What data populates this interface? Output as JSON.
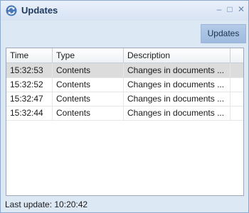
{
  "window": {
    "title": "Updates",
    "controls": {
      "minimize": "–",
      "maximize": "□",
      "close": "✕"
    }
  },
  "toolbar": {
    "updates_button": "Updates"
  },
  "grid": {
    "columns": [
      "Time",
      "Type",
      "Description"
    ],
    "rows": [
      {
        "time": "15:32:53",
        "type": "Contents",
        "description": "Changes in documents ..."
      },
      {
        "time": "15:32:52",
        "type": "Contents",
        "description": "Changes in documents ..."
      },
      {
        "time": "15:32:47",
        "type": "Contents",
        "description": "Changes in documents ..."
      },
      {
        "time": "15:32:44",
        "type": "Contents",
        "description": "Changes in documents ..."
      }
    ],
    "selected_row": 0
  },
  "status": {
    "text": "Last update: 10:20:42"
  },
  "colors": {
    "accent": "#9fbadf",
    "title": "#1f3a60",
    "selection": "#dcdcdc"
  },
  "icons": {
    "app": "refresh-arrows-icon"
  }
}
